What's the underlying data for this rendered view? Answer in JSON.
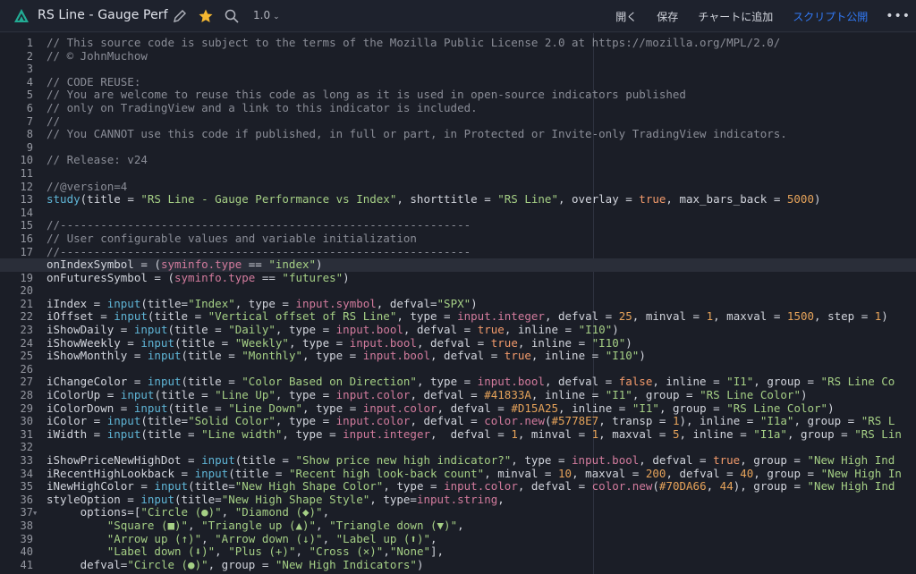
{
  "header": {
    "title": "RS Line - Gauge Perf",
    "version": "1.0",
    "actions": [
      "開く",
      "保存",
      "チャートに追加",
      "スクリプト公開"
    ],
    "more": "•••",
    "icons": [
      "logo-icon",
      "pencil-icon",
      "star-icon",
      "search-icon",
      "chevron-down-icon",
      "more-icon"
    ],
    "colors": {
      "star": "#f5b731",
      "logo": "#22ab94",
      "publish": "#3179f5"
    }
  },
  "editor": {
    "line_numbers": [
      "1",
      "2",
      "3",
      "4",
      "5",
      "6",
      "7",
      "8",
      "9",
      "10",
      "11",
      "12",
      "13",
      "14",
      "15",
      "16",
      "17",
      "18",
      "19",
      "20",
      "21",
      "22",
      "23",
      "24",
      "25",
      "26",
      "27",
      "28",
      "29",
      "30",
      "31",
      "32",
      "33",
      "34",
      "35",
      "36",
      "37",
      "38",
      "39",
      "40",
      "41"
    ],
    "current_line": 18,
    "lines": [
      "// This source code is subject to the terms of the Mozilla Public License 2.0 at https://mozilla.org/MPL/2.0/",
      "// © JohnMuchow",
      "",
      "// CODE REUSE:",
      "// You are welcome to reuse this code as long as it is used in open-source indicators published",
      "// only on TradingView and a link to this indicator is included.",
      "//",
      "// You CANNOT use this code if published, in full or part, in Protected or Invite-only TradingView indicators.",
      "",
      "// Release: v24",
      "",
      "//@version=4",
      "study(title = \"RS Line - Gauge Performance vs Index\", shorttitle = \"RS Line\", overlay = true, max_bars_back = 5000)",
      "",
      "//-------------------------------------------------------------",
      "// User configurable values and variable initialization",
      "//-------------------------------------------------------------",
      "onIndexSymbol = (syminfo.type == \"index\")",
      "onFuturesSymbol = (syminfo.type == \"futures\")",
      "",
      "iIndex = input(title=\"Index\", type = input.symbol, defval=\"SPX\")",
      "iOffset = input(title = \"Vertical offset of RS Line\", type = input.integer, defval = 25, minval = 1, maxval = 1500, step = 1)",
      "iShowDaily = input(title = \"Daily\", type = input.bool, defval = true, inline = \"I10\")",
      "iShowWeekly = input(title = \"Weekly\", type = input.bool, defval = true, inline = \"I10\")",
      "iShowMonthly = input(title = \"Monthly\", type = input.bool, defval = true, inline = \"I10\")",
      "",
      "iChangeColor = input(title = \"Color Based on Direction\", type = input.bool, defval = false, inline = \"I1\", group = \"RS Line Co",
      "iColorUp = input(title = \"Line Up\", type = input.color, defval = #41833A, inline = \"I1\", group = \"RS Line Color\")",
      "iColorDown = input(title = \"Line Down\", type = input.color, defval = #D15A25, inline = \"I1\", group = \"RS Line Color\")",
      "iColor = input(title=\"Solid Color\", type = input.color, defval = color.new(#5778E7, transp = 1), inline = \"I1a\", group = \"RS L",
      "iWidth = input(title = \"Line width\", type = input.integer,  defval = 1, minval = 1, maxval = 5, inline = \"I1a\", group = \"RS Lin",
      "",
      "iShowPriceNewHighDot = input(title = \"Show price new high indicator?\", type = input.bool, defval = true, group = \"New High Ind",
      "iRecentHighLookback = input(title = \"Recent high look-back count\", minval = 10, maxval = 200, defval = 40, group = \"New High In",
      "iNewHighColor = input(title=\"New High Shape Color\", type = input.color, defval = color.new(#70DA66, 44), group = \"New High Ind",
      "styleOption = input(title=\"New High Shape Style\", type=input.string,",
      "     options=[\"Circle (●)\", \"Diamond (◆)\",",
      "         \"Square (■)\", \"Triangle up (▲)\", \"Triangle down (▼)\",",
      "         \"Arrow up (↑)\", \"Arrow down (↓)\", \"Label up (⬆)\",",
      "         \"Label down (⬇)\", \"Plus (+)\", \"Cross (×)\",\"None\"],",
      "     defval=\"Circle (●)\", group = \"New High Indicators\")"
    ]
  }
}
